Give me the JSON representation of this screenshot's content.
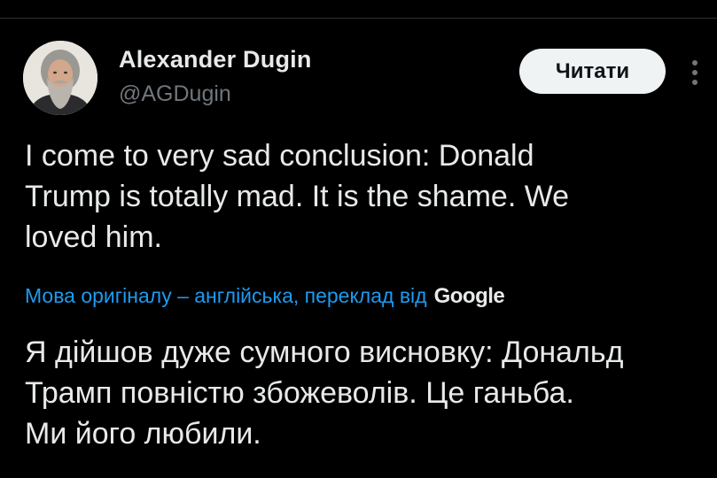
{
  "author": {
    "display_name": "Alexander Dugin",
    "handle": "@AGDugin"
  },
  "actions": {
    "follow_label": "Читати",
    "more_icon": "more-vertical-icon"
  },
  "tweet": {
    "text_lines": [
      "I come to very sad conclusion: Donald",
      "Trump is totally mad. It is the shame. We",
      "loved him."
    ]
  },
  "translation": {
    "link_text": "Мова оригіналу – англійська, переклад від",
    "provider": "Google",
    "text_lines": [
      "Я дійшов дуже сумного висновку: Дональд",
      "Трамп повністю збожеволів. Це ганьба.",
      "Ми його любили."
    ]
  },
  "colors": {
    "background": "#000000",
    "text_primary": "#e7e9ea",
    "text_secondary": "#71767b",
    "link": "#1d9bf0",
    "button_bg": "#eff3f4",
    "button_text": "#0f1419"
  }
}
